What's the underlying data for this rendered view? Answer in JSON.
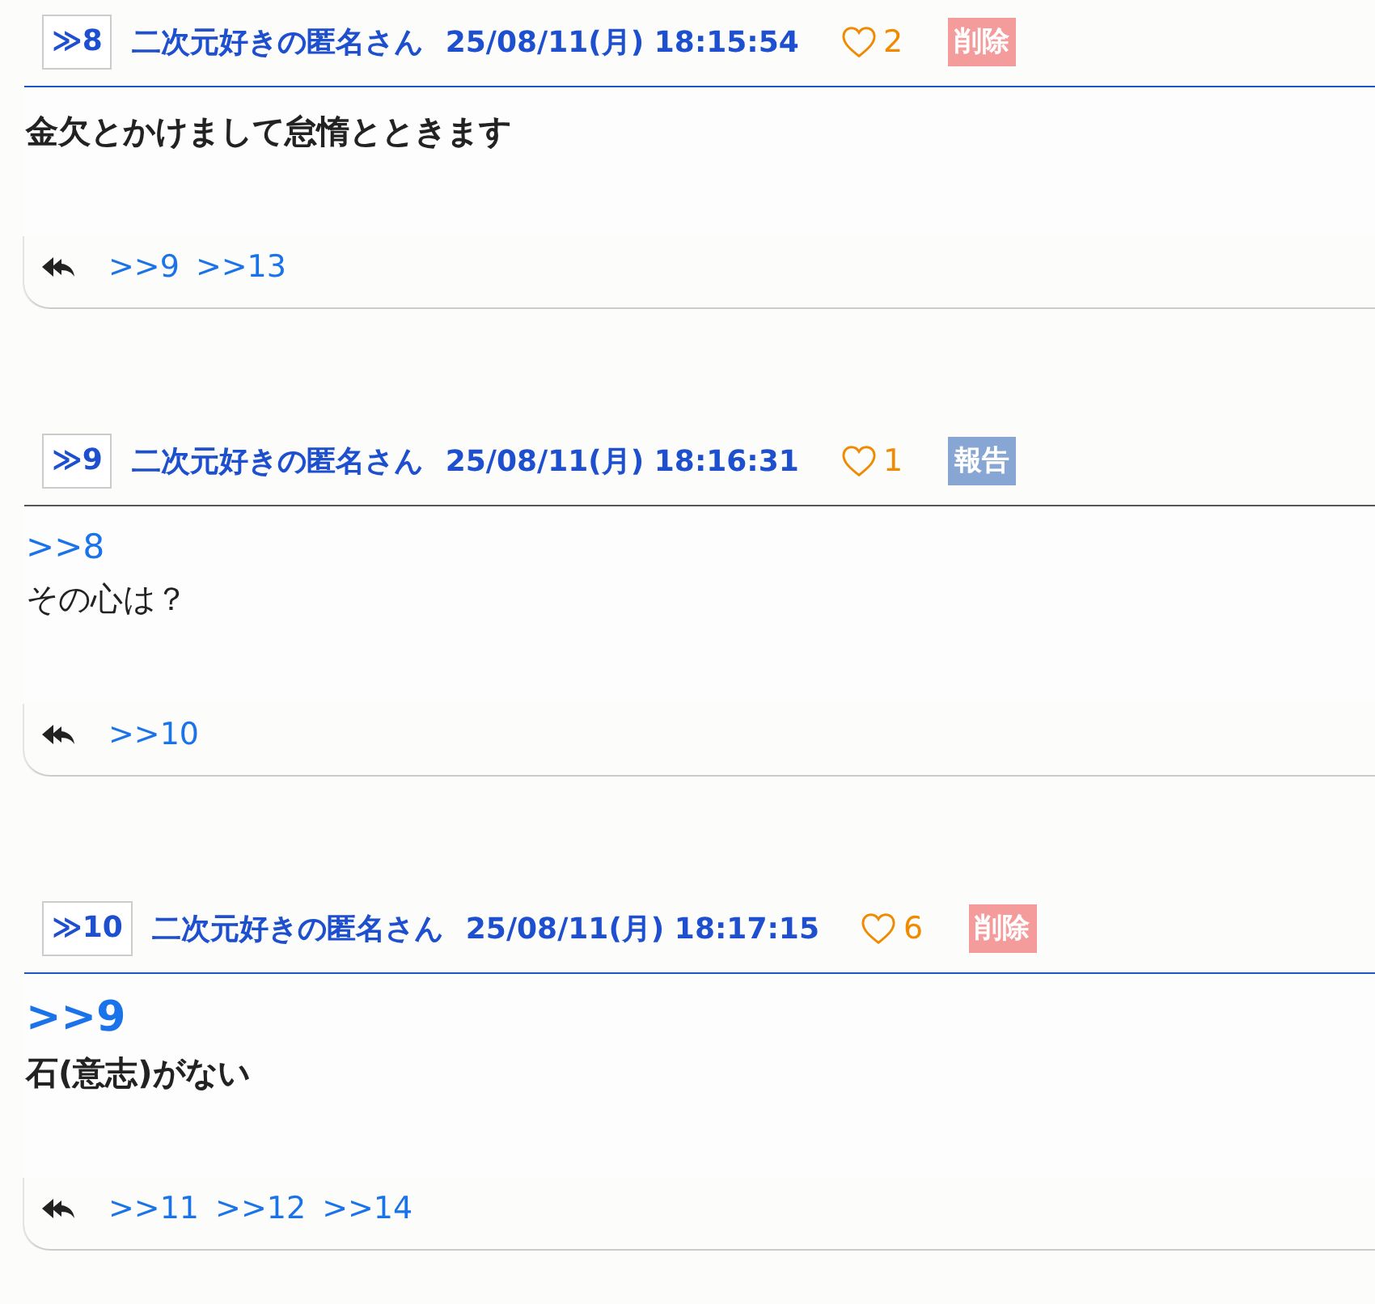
{
  "posts": [
    {
      "number": "≫8",
      "name": "二次元好きの匿名さん",
      "date": "25/08/11(月) 18:15:54",
      "likes": "2",
      "action": {
        "kind": "delete",
        "label": "削除"
      },
      "emphasized": true,
      "body": [
        {
          "kind": "text",
          "text": "金欠とかけまして怠惰とときます"
        }
      ],
      "replies": [
        ">>9",
        ">>13"
      ]
    },
    {
      "number": "≫9",
      "name": "二次元好きの匿名さん",
      "date": "25/08/11(月) 18:16:31",
      "likes": "1",
      "action": {
        "kind": "report",
        "label": "報告"
      },
      "emphasized": false,
      "body": [
        {
          "kind": "link",
          "text": ">>8"
        },
        {
          "kind": "text",
          "text": "その心は？"
        }
      ],
      "replies": [
        ">>10"
      ]
    },
    {
      "number": "≫10",
      "name": "二次元好きの匿名さん",
      "date": "25/08/11(月) 18:17:15",
      "likes": "6",
      "action": {
        "kind": "delete",
        "label": "削除"
      },
      "emphasized": true,
      "body": [
        {
          "kind": "link",
          "text": ">>9"
        },
        {
          "kind": "text",
          "text": "石(意志)がない"
        }
      ],
      "replies": [
        ">>11",
        ">>12",
        ">>14"
      ]
    }
  ]
}
